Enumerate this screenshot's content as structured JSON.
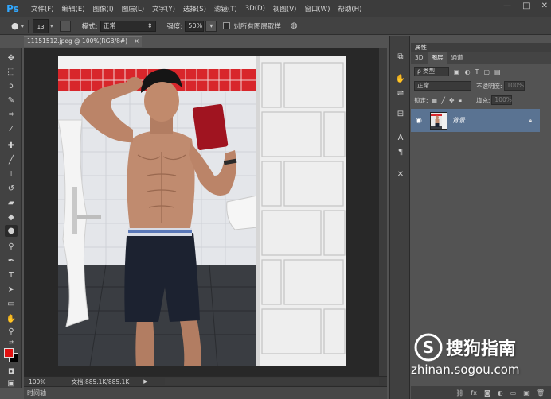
{
  "app": {
    "logo": "Ps",
    "window_controls": [
      "—",
      "□",
      "✕"
    ]
  },
  "menu": [
    "文件(F)",
    "编辑(E)",
    "图像(I)",
    "图层(L)",
    "文字(Y)",
    "选择(S)",
    "滤镜(T)",
    "3D(D)",
    "视图(V)",
    "窗口(W)",
    "帮助(H)"
  ],
  "options": {
    "brush_size": "13",
    "mode_label": "模式:",
    "mode_value": "正常",
    "strength_label": "强度:",
    "strength_value": "50%",
    "sample_all_label": "对所有图层取样"
  },
  "document": {
    "tab_title": "11151512.jpeg @ 100%(RGB/8#)",
    "tab_close": "×",
    "zoom": "100%",
    "doc_info": "文档:885.1K/885.1K",
    "timeline_label": "时间轴"
  },
  "colors": {
    "foreground": "#e01010",
    "background": "#000000",
    "selected_layer": "#5a7392"
  },
  "layers_panel": {
    "title": "属性",
    "tabs": [
      "3D",
      "图层",
      "通道"
    ],
    "active_tab": "图层",
    "filter_kind": "ρ 类型",
    "blend_mode": "正常",
    "opacity_label": "不透明度:",
    "opacity_value": "100%",
    "lock_label": "锁定:",
    "fill_label": "填充:",
    "fill_value": "100%",
    "layer_name": "背景"
  },
  "watermark": {
    "title": "搜狗指南",
    "url": "zhinan.sogou.com"
  }
}
